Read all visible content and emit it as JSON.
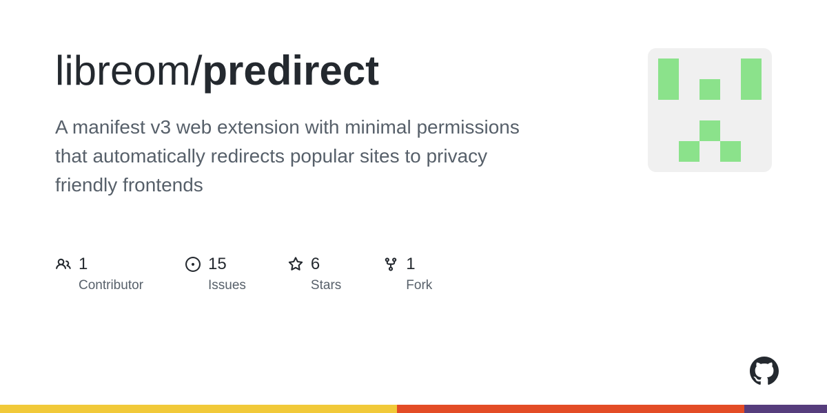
{
  "repo": {
    "owner": "libreom",
    "name": "predirect",
    "separator": "/"
  },
  "description": "A manifest v3 web extension with minimal permissions that automatically redirects popular sites to privacy friendly frontends",
  "stats": {
    "contributors": {
      "value": "1",
      "label": "Contributor"
    },
    "issues": {
      "value": "15",
      "label": "Issues"
    },
    "stars": {
      "value": "6",
      "label": "Stars"
    },
    "forks": {
      "value": "1",
      "label": "Fork"
    }
  },
  "colors": {
    "identicon": "#8be28b",
    "bar": [
      {
        "color": "#f1c939",
        "width": "48%"
      },
      {
        "color": "#e34c26",
        "width": "42%"
      },
      {
        "color": "#563d7c",
        "width": "10%"
      }
    ]
  }
}
